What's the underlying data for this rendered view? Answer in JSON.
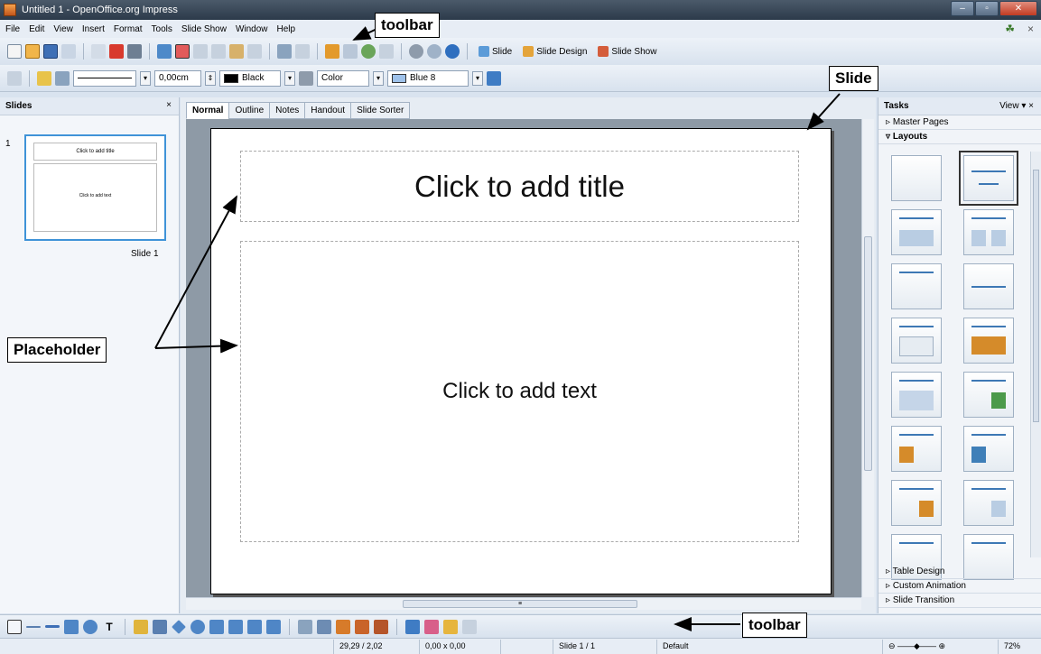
{
  "window": {
    "title": "Untitled 1 - OpenOffice.org Impress"
  },
  "menu": [
    "File",
    "Edit",
    "View",
    "Insert",
    "Format",
    "Tools",
    "Slide Show",
    "Window",
    "Help"
  ],
  "toolbar1": {
    "slide_label": "Slide",
    "slide_design_label": "Slide Design",
    "slide_show_label": "Slide Show"
  },
  "toolbar2": {
    "line_width": "0,00cm",
    "line_color": "Black",
    "area_style": "Color",
    "area_color": "Blue 8"
  },
  "slides_pane": {
    "header": "Slides",
    "close": "×",
    "slide_number": "1",
    "thumb_title": "Click to add title",
    "thumb_text": "Click to add text",
    "slide_label": "Slide 1"
  },
  "tabs": [
    "Normal",
    "Outline",
    "Notes",
    "Handout",
    "Slide Sorter"
  ],
  "slide": {
    "title_placeholder": "Click to add title",
    "text_placeholder": "Click to add text"
  },
  "tasks_pane": {
    "header": "Tasks",
    "view": "View ▾ ×",
    "master_pages": "Master Pages",
    "layouts": "Layouts",
    "table_design": "Table Design",
    "custom_animation": "Custom Animation",
    "slide_transition": "Slide Transition"
  },
  "annotations": {
    "toolbar_top": "toolbar",
    "slide": "Slide",
    "placeholder": "Placeholder",
    "toolbar_bottom": "toolbar"
  },
  "status": {
    "position": "29,29 / 2,02",
    "size": "0,00 x 0,00",
    "slide": "Slide 1 / 1",
    "layout": "Default",
    "zoom": "72%"
  }
}
